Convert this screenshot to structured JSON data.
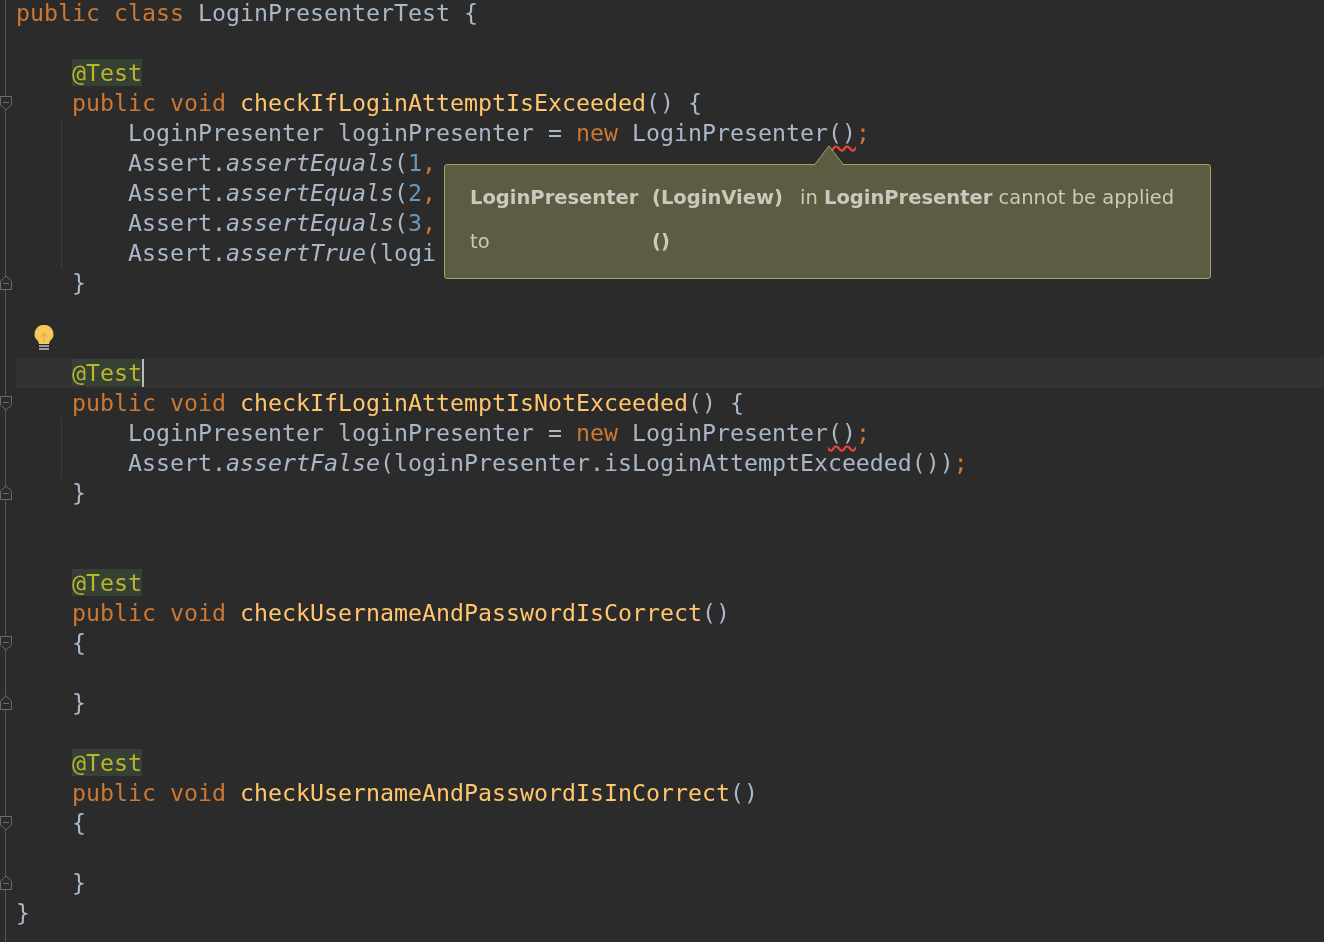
{
  "editor": {
    "lines": [
      {
        "kind": "code",
        "tokens": [
          {
            "text": "public class",
            "kind": "keyword"
          },
          {
            "text": " LoginPresenterTest {",
            "kind": "plain"
          }
        ]
      },
      {
        "kind": "blank"
      },
      {
        "kind": "code",
        "tokens": [
          {
            "text": "    @Test",
            "kind": "annotation"
          }
        ]
      },
      {
        "kind": "code",
        "fold_start": true,
        "tokens": [
          {
            "text": "    public void",
            "kind": "keyword"
          },
          {
            "text": " checkIfLoginAttemptIsExceeded",
            "kind": "method"
          },
          {
            "text": "() {",
            "kind": "plain"
          }
        ]
      },
      {
        "kind": "code",
        "guide": true,
        "tokens": [
          {
            "text": "        LoginPresenter loginPresenter = ",
            "kind": "plain"
          },
          {
            "text": "new",
            "kind": "keyword"
          },
          {
            "text": " LoginPresenter",
            "kind": "plain"
          },
          {
            "text": "()",
            "kind": "error"
          },
          {
            "text": ";",
            "kind": "keyword"
          }
        ]
      },
      {
        "kind": "code",
        "guide": true,
        "tokens": [
          {
            "text": "        Assert.",
            "kind": "plain"
          },
          {
            "text": "assertEquals",
            "kind": "call"
          },
          {
            "text": "(",
            "kind": "plain"
          },
          {
            "text": "1",
            "kind": "number"
          },
          {
            "text": ",",
            "kind": "keyword"
          }
        ]
      },
      {
        "kind": "code",
        "guide": true,
        "tokens": [
          {
            "text": "        Assert.",
            "kind": "plain"
          },
          {
            "text": "assertEquals",
            "kind": "call"
          },
          {
            "text": "(",
            "kind": "plain"
          },
          {
            "text": "2",
            "kind": "number"
          },
          {
            "text": ",",
            "kind": "keyword"
          }
        ]
      },
      {
        "kind": "code",
        "guide": true,
        "tokens": [
          {
            "text": "        Assert.",
            "kind": "plain"
          },
          {
            "text": "assertEquals",
            "kind": "call"
          },
          {
            "text": "(",
            "kind": "plain"
          },
          {
            "text": "3",
            "kind": "number"
          },
          {
            "text": ",",
            "kind": "keyword"
          }
        ]
      },
      {
        "kind": "code",
        "guide": true,
        "tokens": [
          {
            "text": "        Assert.",
            "kind": "plain"
          },
          {
            "text": "assertTrue",
            "kind": "call"
          },
          {
            "text": "(logi",
            "kind": "plain"
          }
        ]
      },
      {
        "kind": "code",
        "fold_end": true,
        "tokens": [
          {
            "text": "    }",
            "kind": "plain"
          }
        ]
      },
      {
        "kind": "blank"
      },
      {
        "kind": "blank",
        "lightbulb": true
      },
      {
        "kind": "code",
        "current": true,
        "tokens": [
          {
            "text": "    @Test",
            "kind": "annotation",
            "caret": true
          }
        ]
      },
      {
        "kind": "code",
        "fold_start": true,
        "tokens": [
          {
            "text": "    public void",
            "kind": "keyword"
          },
          {
            "text": " checkIfLoginAttemptIsNotExceeded",
            "kind": "method"
          },
          {
            "text": "() {",
            "kind": "plain"
          }
        ]
      },
      {
        "kind": "code",
        "guide": true,
        "tokens": [
          {
            "text": "        LoginPresenter loginPresenter = ",
            "kind": "plain"
          },
          {
            "text": "new",
            "kind": "keyword"
          },
          {
            "text": " LoginPresenter",
            "kind": "plain"
          },
          {
            "text": "()",
            "kind": "error"
          },
          {
            "text": ";",
            "kind": "keyword"
          }
        ]
      },
      {
        "kind": "code",
        "guide": true,
        "tokens": [
          {
            "text": "        Assert.",
            "kind": "plain"
          },
          {
            "text": "assertFalse",
            "kind": "call"
          },
          {
            "text": "(loginPresenter.isLoginAttemptExceeded())",
            "kind": "plain"
          },
          {
            "text": ";",
            "kind": "keyword"
          }
        ]
      },
      {
        "kind": "code",
        "fold_end": true,
        "tokens": [
          {
            "text": "    }",
            "kind": "plain"
          }
        ]
      },
      {
        "kind": "blank"
      },
      {
        "kind": "blank"
      },
      {
        "kind": "code",
        "tokens": [
          {
            "text": "    @Test",
            "kind": "annotation"
          }
        ]
      },
      {
        "kind": "code",
        "tokens": [
          {
            "text": "    public void",
            "kind": "keyword"
          },
          {
            "text": " checkUsernameAndPasswordIsCorrect",
            "kind": "method"
          },
          {
            "text": "()",
            "kind": "plain"
          }
        ]
      },
      {
        "kind": "code",
        "fold_start": true,
        "tokens": [
          {
            "text": "    {",
            "kind": "plain"
          }
        ]
      },
      {
        "kind": "blank"
      },
      {
        "kind": "code",
        "fold_end": true,
        "tokens": [
          {
            "text": "    }",
            "kind": "plain"
          }
        ]
      },
      {
        "kind": "blank"
      },
      {
        "kind": "code",
        "tokens": [
          {
            "text": "    @Test",
            "kind": "annotation"
          }
        ]
      },
      {
        "kind": "code",
        "tokens": [
          {
            "text": "    public void",
            "kind": "keyword"
          },
          {
            "text": " checkUsernameAndPasswordIsInCorrect",
            "kind": "method"
          },
          {
            "text": "()",
            "kind": "plain"
          }
        ]
      },
      {
        "kind": "code",
        "fold_start": true,
        "tokens": [
          {
            "text": "    {",
            "kind": "plain"
          }
        ]
      },
      {
        "kind": "blank"
      },
      {
        "kind": "code",
        "fold_end": true,
        "tokens": [
          {
            "text": "    }",
            "kind": "plain"
          }
        ]
      },
      {
        "kind": "code",
        "tokens": [
          {
            "text": "}",
            "kind": "plain"
          }
        ]
      }
    ]
  },
  "tooltip": {
    "rows": [
      [
        "**LoginPresenter**",
        "**(LoginView)**",
        "in **LoginPresenter** cannot be applied"
      ],
      [
        "to",
        "**()**"
      ]
    ]
  }
}
